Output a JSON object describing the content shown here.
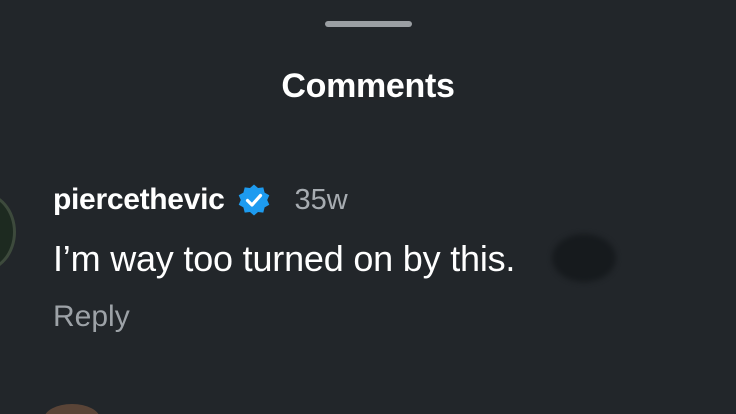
{
  "sheet": {
    "title": "Comments"
  },
  "comment": {
    "username": "piercethevic",
    "verified": true,
    "timestamp": "35w",
    "text": "I’m way too turned on by this.",
    "reply_label": "Reply"
  },
  "colors": {
    "background": "#22262a",
    "verified_badge": "#1d9bf0",
    "text_primary": "#ffffff",
    "text_secondary": "#9da2a7"
  },
  "icons": {
    "verified": "verified-badge-icon"
  }
}
